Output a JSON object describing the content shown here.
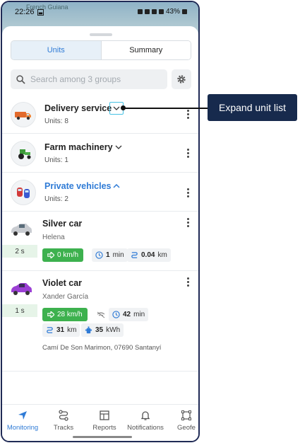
{
  "status": {
    "time": "22:26",
    "battery": "43%"
  },
  "map": {
    "label": "French Guiana"
  },
  "tabs": [
    {
      "label": "Units"
    },
    {
      "label": "Summary"
    }
  ],
  "search": {
    "placeholder": "Search among 3 groups"
  },
  "groups": [
    {
      "name": "Delivery service",
      "count": "Units: 8",
      "icon": "delivery-van-icon",
      "state": "collapsed"
    },
    {
      "name": "Farm machinery",
      "count": "Units: 1",
      "icon": "tractor-icon",
      "state": "collapsed"
    },
    {
      "name": "Private vehicles",
      "count": "Units: 2",
      "icon": "cars-icon",
      "state": "expanded"
    }
  ],
  "units": [
    {
      "name": "Silver car",
      "driver": "Helena",
      "last_message": "2 s",
      "speed": "0 km/h",
      "duration": "1",
      "duration_unit": "min",
      "distance": "0.04",
      "distance_unit": "km"
    },
    {
      "name": "Violet car",
      "driver": "Xander García",
      "last_message": "1 s",
      "speed": "28 km/h",
      "duration": "42",
      "duration_unit": "min",
      "distance": "31",
      "distance_unit": "km",
      "fuel": "35",
      "fuel_unit": "kWh",
      "address": "Camí De Son Marimon, 07690 Santanyí"
    }
  ],
  "nav": [
    {
      "label": "Monitoring",
      "icon": "navigation-arrow-icon"
    },
    {
      "label": "Tracks",
      "icon": "route-icon"
    },
    {
      "label": "Reports",
      "icon": "report-table-icon"
    },
    {
      "label": "Notifications",
      "icon": "bell-icon"
    },
    {
      "label": "Geofe",
      "icon": "geofence-icon"
    }
  ],
  "callout": {
    "text": "Expand unit list"
  },
  "colors": {
    "accent": "#2f7bd6",
    "speed": "#3db14e",
    "callout": "#172a4d",
    "highlight": "#46c2e4"
  }
}
